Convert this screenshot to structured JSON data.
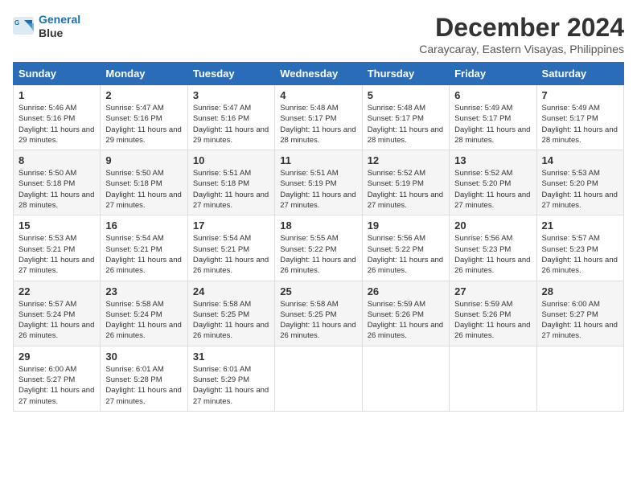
{
  "header": {
    "logo_line1": "General",
    "logo_line2": "Blue",
    "month_title": "December 2024",
    "location": "Caraycaray, Eastern Visayas, Philippines"
  },
  "days_of_week": [
    "Sunday",
    "Monday",
    "Tuesday",
    "Wednesday",
    "Thursday",
    "Friday",
    "Saturday"
  ],
  "weeks": [
    [
      {
        "day": "1",
        "sunrise": "Sunrise: 5:46 AM",
        "sunset": "Sunset: 5:16 PM",
        "daylight": "Daylight: 11 hours and 29 minutes."
      },
      {
        "day": "2",
        "sunrise": "Sunrise: 5:47 AM",
        "sunset": "Sunset: 5:16 PM",
        "daylight": "Daylight: 11 hours and 29 minutes."
      },
      {
        "day": "3",
        "sunrise": "Sunrise: 5:47 AM",
        "sunset": "Sunset: 5:16 PM",
        "daylight": "Daylight: 11 hours and 29 minutes."
      },
      {
        "day": "4",
        "sunrise": "Sunrise: 5:48 AM",
        "sunset": "Sunset: 5:17 PM",
        "daylight": "Daylight: 11 hours and 28 minutes."
      },
      {
        "day": "5",
        "sunrise": "Sunrise: 5:48 AM",
        "sunset": "Sunset: 5:17 PM",
        "daylight": "Daylight: 11 hours and 28 minutes."
      },
      {
        "day": "6",
        "sunrise": "Sunrise: 5:49 AM",
        "sunset": "Sunset: 5:17 PM",
        "daylight": "Daylight: 11 hours and 28 minutes."
      },
      {
        "day": "7",
        "sunrise": "Sunrise: 5:49 AM",
        "sunset": "Sunset: 5:17 PM",
        "daylight": "Daylight: 11 hours and 28 minutes."
      }
    ],
    [
      {
        "day": "8",
        "sunrise": "Sunrise: 5:50 AM",
        "sunset": "Sunset: 5:18 PM",
        "daylight": "Daylight: 11 hours and 28 minutes."
      },
      {
        "day": "9",
        "sunrise": "Sunrise: 5:50 AM",
        "sunset": "Sunset: 5:18 PM",
        "daylight": "Daylight: 11 hours and 27 minutes."
      },
      {
        "day": "10",
        "sunrise": "Sunrise: 5:51 AM",
        "sunset": "Sunset: 5:18 PM",
        "daylight": "Daylight: 11 hours and 27 minutes."
      },
      {
        "day": "11",
        "sunrise": "Sunrise: 5:51 AM",
        "sunset": "Sunset: 5:19 PM",
        "daylight": "Daylight: 11 hours and 27 minutes."
      },
      {
        "day": "12",
        "sunrise": "Sunrise: 5:52 AM",
        "sunset": "Sunset: 5:19 PM",
        "daylight": "Daylight: 11 hours and 27 minutes."
      },
      {
        "day": "13",
        "sunrise": "Sunrise: 5:52 AM",
        "sunset": "Sunset: 5:20 PM",
        "daylight": "Daylight: 11 hours and 27 minutes."
      },
      {
        "day": "14",
        "sunrise": "Sunrise: 5:53 AM",
        "sunset": "Sunset: 5:20 PM",
        "daylight": "Daylight: 11 hours and 27 minutes."
      }
    ],
    [
      {
        "day": "15",
        "sunrise": "Sunrise: 5:53 AM",
        "sunset": "Sunset: 5:21 PM",
        "daylight": "Daylight: 11 hours and 27 minutes."
      },
      {
        "day": "16",
        "sunrise": "Sunrise: 5:54 AM",
        "sunset": "Sunset: 5:21 PM",
        "daylight": "Daylight: 11 hours and 26 minutes."
      },
      {
        "day": "17",
        "sunrise": "Sunrise: 5:54 AM",
        "sunset": "Sunset: 5:21 PM",
        "daylight": "Daylight: 11 hours and 26 minutes."
      },
      {
        "day": "18",
        "sunrise": "Sunrise: 5:55 AM",
        "sunset": "Sunset: 5:22 PM",
        "daylight": "Daylight: 11 hours and 26 minutes."
      },
      {
        "day": "19",
        "sunrise": "Sunrise: 5:56 AM",
        "sunset": "Sunset: 5:22 PM",
        "daylight": "Daylight: 11 hours and 26 minutes."
      },
      {
        "day": "20",
        "sunrise": "Sunrise: 5:56 AM",
        "sunset": "Sunset: 5:23 PM",
        "daylight": "Daylight: 11 hours and 26 minutes."
      },
      {
        "day": "21",
        "sunrise": "Sunrise: 5:57 AM",
        "sunset": "Sunset: 5:23 PM",
        "daylight": "Daylight: 11 hours and 26 minutes."
      }
    ],
    [
      {
        "day": "22",
        "sunrise": "Sunrise: 5:57 AM",
        "sunset": "Sunset: 5:24 PM",
        "daylight": "Daylight: 11 hours and 26 minutes."
      },
      {
        "day": "23",
        "sunrise": "Sunrise: 5:58 AM",
        "sunset": "Sunset: 5:24 PM",
        "daylight": "Daylight: 11 hours and 26 minutes."
      },
      {
        "day": "24",
        "sunrise": "Sunrise: 5:58 AM",
        "sunset": "Sunset: 5:25 PM",
        "daylight": "Daylight: 11 hours and 26 minutes."
      },
      {
        "day": "25",
        "sunrise": "Sunrise: 5:58 AM",
        "sunset": "Sunset: 5:25 PM",
        "daylight": "Daylight: 11 hours and 26 minutes."
      },
      {
        "day": "26",
        "sunrise": "Sunrise: 5:59 AM",
        "sunset": "Sunset: 5:26 PM",
        "daylight": "Daylight: 11 hours and 26 minutes."
      },
      {
        "day": "27",
        "sunrise": "Sunrise: 5:59 AM",
        "sunset": "Sunset: 5:26 PM",
        "daylight": "Daylight: 11 hours and 26 minutes."
      },
      {
        "day": "28",
        "sunrise": "Sunrise: 6:00 AM",
        "sunset": "Sunset: 5:27 PM",
        "daylight": "Daylight: 11 hours and 27 minutes."
      }
    ],
    [
      {
        "day": "29",
        "sunrise": "Sunrise: 6:00 AM",
        "sunset": "Sunset: 5:27 PM",
        "daylight": "Daylight: 11 hours and 27 minutes."
      },
      {
        "day": "30",
        "sunrise": "Sunrise: 6:01 AM",
        "sunset": "Sunset: 5:28 PM",
        "daylight": "Daylight: 11 hours and 27 minutes."
      },
      {
        "day": "31",
        "sunrise": "Sunrise: 6:01 AM",
        "sunset": "Sunset: 5:29 PM",
        "daylight": "Daylight: 11 hours and 27 minutes."
      },
      {
        "day": "",
        "sunrise": "",
        "sunset": "",
        "daylight": ""
      },
      {
        "day": "",
        "sunrise": "",
        "sunset": "",
        "daylight": ""
      },
      {
        "day": "",
        "sunrise": "",
        "sunset": "",
        "daylight": ""
      },
      {
        "day": "",
        "sunrise": "",
        "sunset": "",
        "daylight": ""
      }
    ]
  ]
}
